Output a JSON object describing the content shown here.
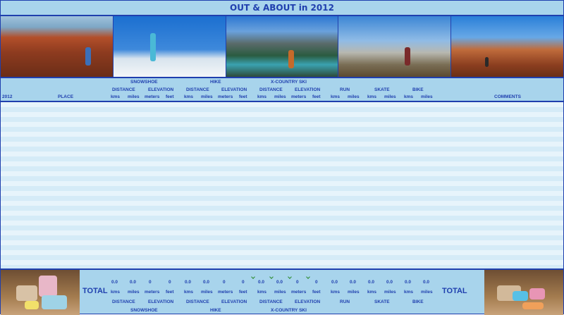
{
  "title": "OUT & ABOUT in 2012",
  "header": {
    "year": "2012",
    "place": "PLACE",
    "comments": "COMMENTS",
    "groups": {
      "snowshoe": "SNOWSHOE",
      "hike": "HIKE",
      "xcountry": "X-COUNTRY SKI",
      "run": "RUN",
      "skate": "SKATE",
      "bike": "BIKE"
    },
    "distance": "DISTANCE",
    "elevation": "ELEVATION",
    "units": {
      "kms": "kms",
      "miles": "miles",
      "meters": "meters",
      "feet": "feet"
    }
  },
  "totals": {
    "label": "TOTAL",
    "values": [
      "0.0",
      "0.0",
      "0",
      "0",
      "0.0",
      "0.0",
      "0",
      "0",
      "0.0",
      "0.0",
      "0",
      "0",
      "0.0",
      "0.0",
      "0.0",
      "0.0",
      "0.0",
      "0.0"
    ]
  },
  "colors": {
    "accent": "#1f3fae",
    "background": "#a8d4ec",
    "row_light": "#e7f4fb",
    "row_dark": "#d5ebf7"
  }
}
